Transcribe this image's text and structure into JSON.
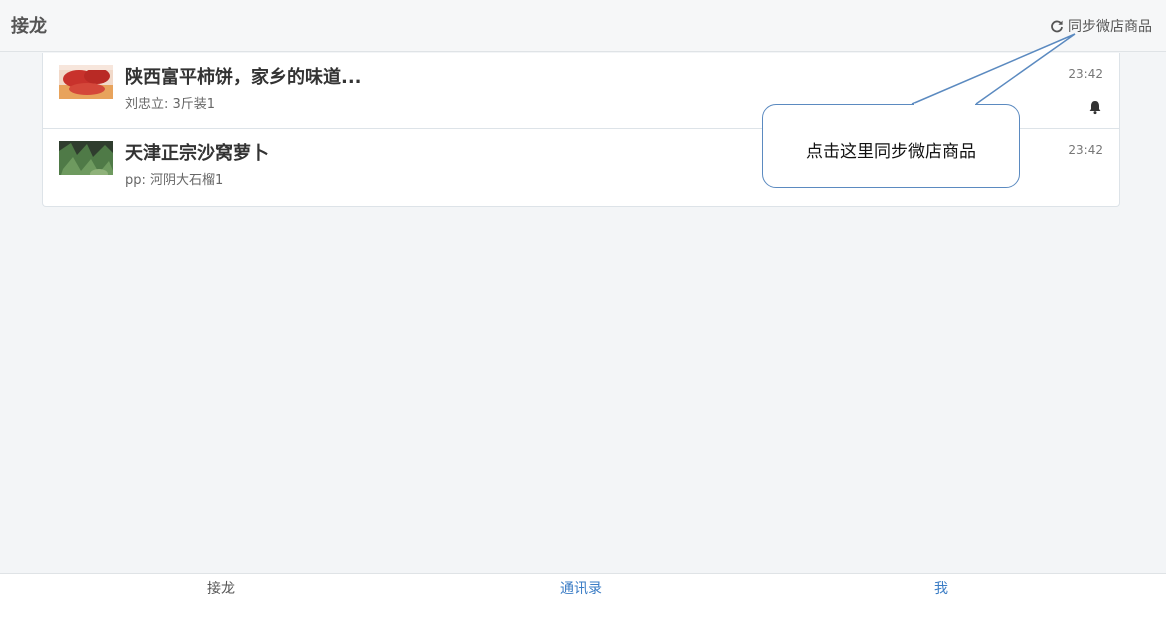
{
  "header": {
    "title": "接龙",
    "sync_label": "同步微店商品",
    "sync_icon": "refresh-icon"
  },
  "items": [
    {
      "title": "陕西富平柿饼，家乡的味道...",
      "subtitle": "刘忠立: 3斤装1",
      "time": "23:42",
      "icon": "bell-icon"
    },
    {
      "title": "天津正宗沙窝萝卜",
      "subtitle": "pp: 河阴大石榴1",
      "time": "23:42"
    }
  ],
  "callout": {
    "text": "点击这里同步微店商品"
  },
  "tabs": [
    {
      "label": "接龙",
      "color": "#555555"
    },
    {
      "label": "通讯录",
      "color": "#3a7cc5"
    },
    {
      "label": "我",
      "color": "#3a7cc5"
    }
  ]
}
